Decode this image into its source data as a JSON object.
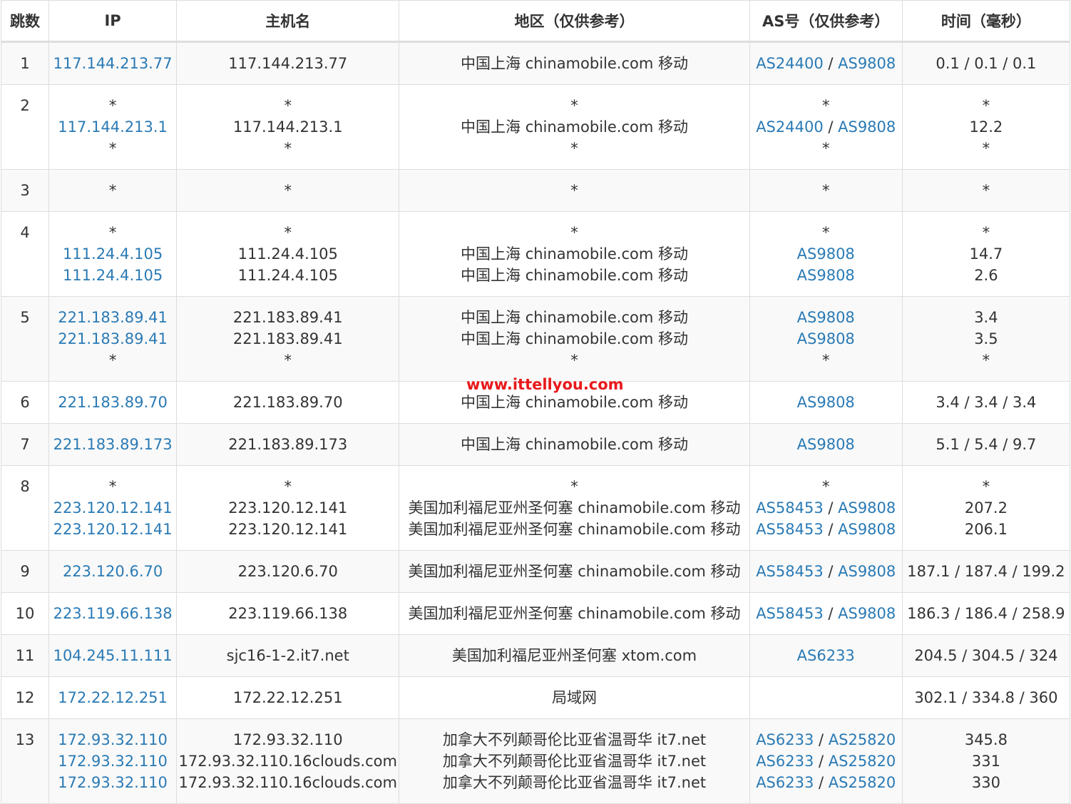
{
  "headers": [
    "跳数",
    "IP",
    "主机名",
    "地区（仅供参考）",
    "AS号（仅供参考）",
    "时间（毫秒）"
  ],
  "watermark": "www.ittellyou.com",
  "rows": [
    {
      "hop": "1",
      "lines": [
        {
          "ip": "117.144.213.77",
          "host": "117.144.213.77",
          "region": "中国上海 chinamobile.com 移动",
          "as": [
            "AS24400",
            "AS9808"
          ],
          "time": "0.1 / 0.1 / 0.1"
        }
      ]
    },
    {
      "hop": "2",
      "lines": [
        {
          "ip": "*",
          "host": "*",
          "region": "*",
          "as": [
            "*"
          ],
          "time": "*"
        },
        {
          "ip": "117.144.213.1",
          "host": "117.144.213.1",
          "region": "中国上海 chinamobile.com 移动",
          "as": [
            "AS24400",
            "AS9808"
          ],
          "time": "12.2"
        },
        {
          "ip": "*",
          "host": "*",
          "region": "*",
          "as": [
            "*"
          ],
          "time": "*"
        }
      ]
    },
    {
      "hop": "3",
      "lines": [
        {
          "ip": "*",
          "host": "*",
          "region": "*",
          "as": [
            "*"
          ],
          "time": "*"
        }
      ]
    },
    {
      "hop": "4",
      "lines": [
        {
          "ip": "*",
          "host": "*",
          "region": "*",
          "as": [
            "*"
          ],
          "time": "*"
        },
        {
          "ip": "111.24.4.105",
          "host": "111.24.4.105",
          "region": "中国上海 chinamobile.com 移动",
          "as": [
            "AS9808"
          ],
          "time": "14.7"
        },
        {
          "ip": "111.24.4.105",
          "host": "111.24.4.105",
          "region": "中国上海 chinamobile.com 移动",
          "as": [
            "AS9808"
          ],
          "time": "2.6"
        }
      ]
    },
    {
      "hop": "5",
      "lines": [
        {
          "ip": "221.183.89.41",
          "host": "221.183.89.41",
          "region": "中国上海 chinamobile.com 移动",
          "as": [
            "AS9808"
          ],
          "time": "3.4"
        },
        {
          "ip": "221.183.89.41",
          "host": "221.183.89.41",
          "region": "中国上海 chinamobile.com 移动",
          "as": [
            "AS9808"
          ],
          "time": "3.5"
        },
        {
          "ip": "*",
          "host": "*",
          "region": "*",
          "as": [
            "*"
          ],
          "time": "*"
        }
      ]
    },
    {
      "hop": "6",
      "lines": [
        {
          "ip": "221.183.89.70",
          "host": "221.183.89.70",
          "region": "中国上海 chinamobile.com 移动",
          "as": [
            "AS9808"
          ],
          "time": "3.4 / 3.4 / 3.4"
        }
      ]
    },
    {
      "hop": "7",
      "lines": [
        {
          "ip": "221.183.89.173",
          "host": "221.183.89.173",
          "region": "中国上海 chinamobile.com 移动",
          "as": [
            "AS9808"
          ],
          "time": "5.1 / 5.4 / 9.7"
        }
      ]
    },
    {
      "hop": "8",
      "lines": [
        {
          "ip": "*",
          "host": "*",
          "region": "*",
          "as": [
            "*"
          ],
          "time": "*"
        },
        {
          "ip": "223.120.12.141",
          "host": "223.120.12.141",
          "region": "美国加利福尼亚州圣何塞 chinamobile.com 移动",
          "as": [
            "AS58453",
            "AS9808"
          ],
          "time": "207.2"
        },
        {
          "ip": "223.120.12.141",
          "host": "223.120.12.141",
          "region": "美国加利福尼亚州圣何塞 chinamobile.com 移动",
          "as": [
            "AS58453",
            "AS9808"
          ],
          "time": "206.1"
        }
      ]
    },
    {
      "hop": "9",
      "lines": [
        {
          "ip": "223.120.6.70",
          "host": "223.120.6.70",
          "region": "美国加利福尼亚州圣何塞 chinamobile.com 移动",
          "as": [
            "AS58453",
            "AS9808"
          ],
          "time": "187.1 / 187.4 / 199.2"
        }
      ]
    },
    {
      "hop": "10",
      "lines": [
        {
          "ip": "223.119.66.138",
          "host": "223.119.66.138",
          "region": "美国加利福尼亚州圣何塞 chinamobile.com 移动",
          "as": [
            "AS58453",
            "AS9808"
          ],
          "time": "186.3 / 186.4 / 258.9"
        }
      ]
    },
    {
      "hop": "11",
      "lines": [
        {
          "ip": "104.245.11.111",
          "host": "sjc16-1-2.it7.net",
          "region": "美国加利福尼亚州圣何塞 xtom.com",
          "as": [
            "AS6233"
          ],
          "time": "204.5 / 304.5 / 324"
        }
      ]
    },
    {
      "hop": "12",
      "lines": [
        {
          "ip": "172.22.12.251",
          "host": "172.22.12.251",
          "region": "局域网",
          "as": [],
          "time": "302.1 / 334.8 / 360"
        }
      ]
    },
    {
      "hop": "13",
      "lines": [
        {
          "ip": "172.93.32.110",
          "host": "172.93.32.110",
          "region": "加拿大不列颠哥伦比亚省温哥华 it7.net",
          "as": [
            "AS6233",
            "AS25820"
          ],
          "time": "345.8"
        },
        {
          "ip": "172.93.32.110",
          "host": "172.93.32.110.16clouds.com",
          "region": "加拿大不列颠哥伦比亚省温哥华 it7.net",
          "as": [
            "AS6233",
            "AS25820"
          ],
          "time": "331"
        },
        {
          "ip": "172.93.32.110",
          "host": "172.93.32.110.16clouds.com",
          "region": "加拿大不列颠哥伦比亚省温哥华 it7.net",
          "as": [
            "AS6233",
            "AS25820"
          ],
          "time": "330"
        }
      ]
    }
  ]
}
